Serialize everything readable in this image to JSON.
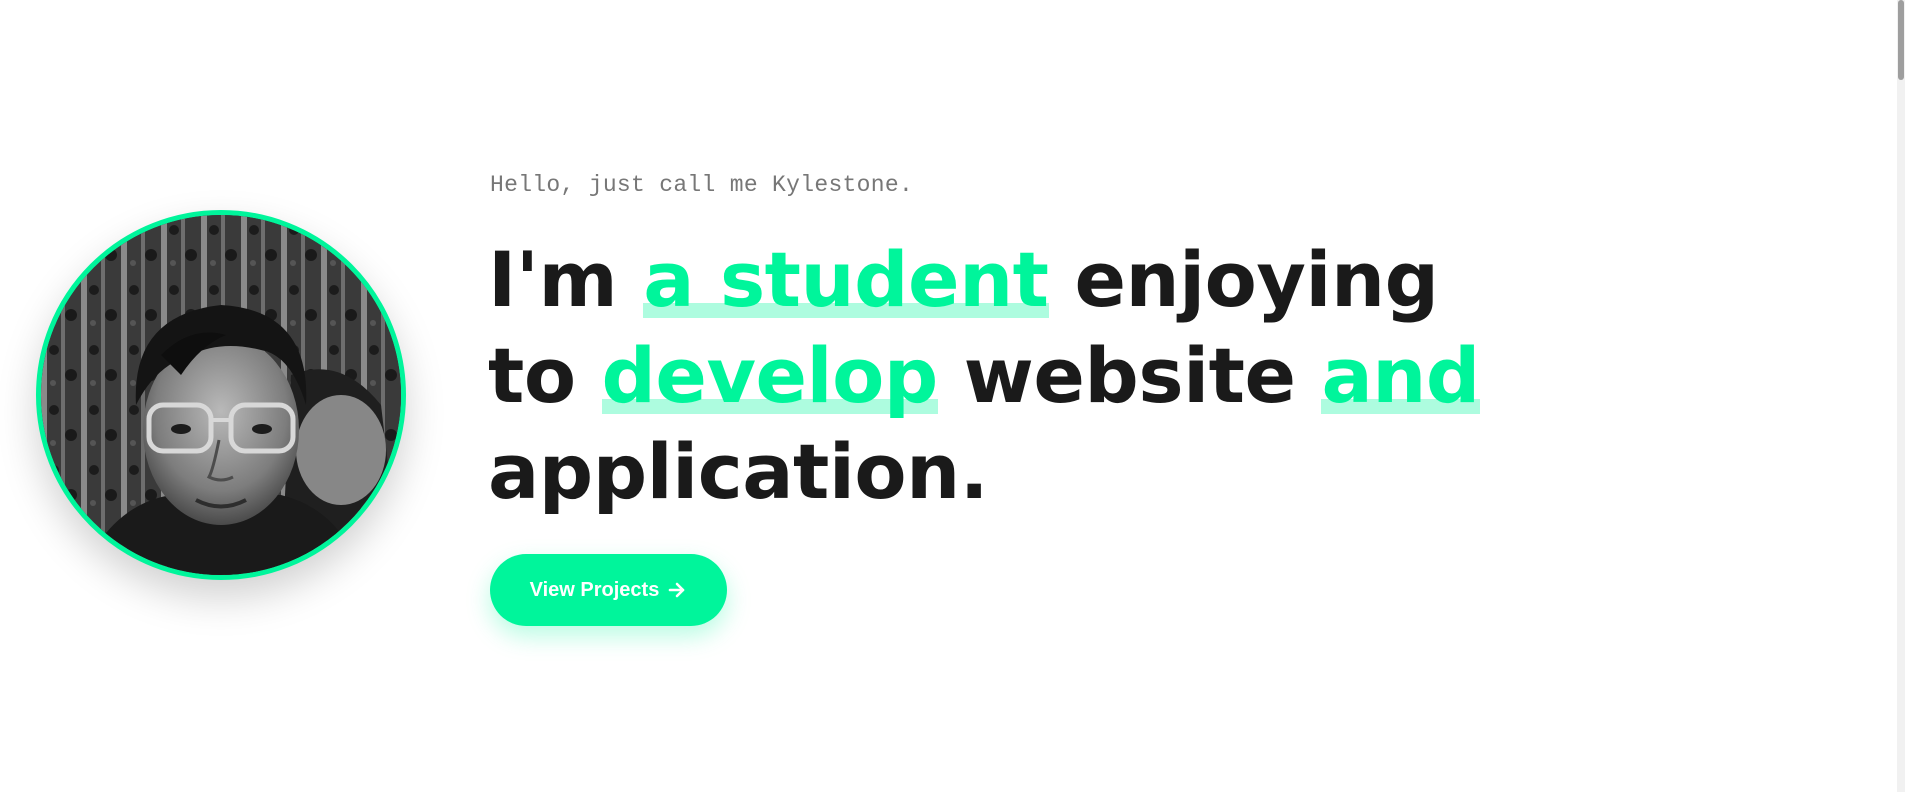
{
  "hero": {
    "greeting": "Hello, just call me Kylestone.",
    "headline": {
      "part1": "I'm ",
      "highlight1": "a student",
      "part2": " enjoying to ",
      "highlight2": "develop",
      "part3": " website ",
      "highlight3": "and",
      "part4": " application."
    },
    "cta_label": "View Projects",
    "cta_icon": "arrow-right-icon"
  },
  "colors": {
    "accent": "#00f59b",
    "headline_text": "#1a1a1a",
    "greeting_text": "#777777",
    "background": "#ffffff"
  },
  "avatar": {
    "icon": "profile-photo"
  }
}
